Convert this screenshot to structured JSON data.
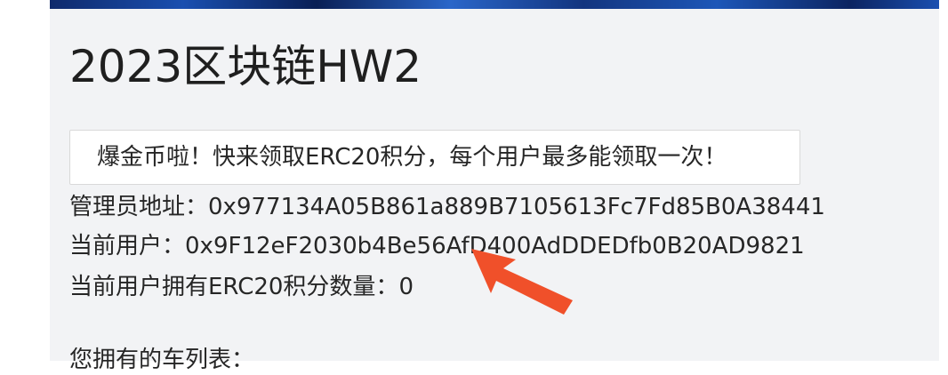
{
  "page": {
    "title": "2023区块链HW2"
  },
  "claim": {
    "button_label": "爆金币啦！快来领取ERC20积分，每个用户最多能领取一次！"
  },
  "info": {
    "admin_label": "管理员地址：",
    "admin_address": "0x977134A05B861a889B7105613Fc7Fd85B0A38441",
    "user_label": "当前用户：",
    "user_address": "0x9F12eF2030b4Be56AfD400AdDDEDfb0B20AD9821",
    "balance_label": "当前用户拥有ERC20积分数量：",
    "balance_value": "0",
    "cars_label": "您拥有的车列表："
  },
  "colors": {
    "panel_bg": "#f2f3f5",
    "text": "#262626",
    "annotation_arrow": "#f0502a"
  },
  "annotation": {
    "icon": "arrow-icon"
  }
}
